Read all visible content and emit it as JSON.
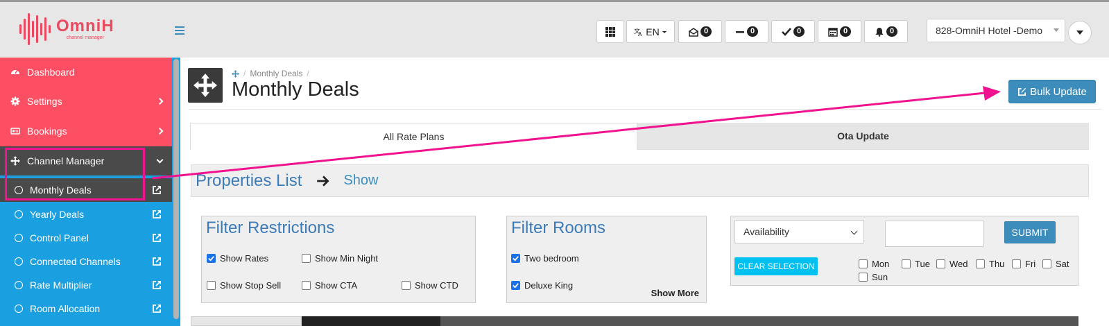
{
  "brand": {
    "name": "OmniH",
    "subtitle": "channel manager",
    "color": "#e84a5f"
  },
  "toolbar": {
    "lang": "EN",
    "counters": [
      {
        "icon": "envelope-open-icon",
        "count": "0"
      },
      {
        "icon": "minus-icon",
        "count": "0"
      },
      {
        "icon": "check-icon",
        "count": "0"
      },
      {
        "icon": "calendar-icon",
        "count": "0"
      },
      {
        "icon": "bell-icon",
        "count": "0"
      }
    ],
    "hotel": "828-OmniH Hotel -Demo"
  },
  "sidebar": {
    "items": [
      {
        "label": "Dashboard",
        "icon": "dashboard-icon"
      },
      {
        "label": "Settings",
        "icon": "gear-icon"
      },
      {
        "label": "Bookings",
        "icon": "bookings-icon"
      },
      {
        "label": "Channel Manager",
        "icon": "move-icon"
      }
    ],
    "subitems": [
      {
        "label": "Monthly Deals"
      },
      {
        "label": "Yearly Deals"
      },
      {
        "label": "Control Panel"
      },
      {
        "label": "Connected Channels"
      },
      {
        "label": "Rate Multiplier"
      },
      {
        "label": "Room Allocation"
      }
    ]
  },
  "page": {
    "breadcrumb": "Monthly Deals",
    "title": "Monthly Deals",
    "bulk_update": "Bulk Update"
  },
  "tabs": [
    {
      "label": "All Rate Plans"
    },
    {
      "label": "Ota Update"
    }
  ],
  "properties": {
    "title": "Properties List",
    "show": "Show"
  },
  "filter_restrictions": {
    "title": "Filter Restrictions",
    "options": [
      {
        "label": "Show Rates",
        "checked": true
      },
      {
        "label": "Show Min Night",
        "checked": false
      },
      {
        "label": "Show Stop Sell",
        "checked": false
      },
      {
        "label": "Show CTA",
        "checked": false
      },
      {
        "label": "Show CTD",
        "checked": false
      }
    ]
  },
  "filter_rooms": {
    "title": "Filter Rooms",
    "options": [
      {
        "label": "Two bedroom",
        "checked": true
      },
      {
        "label": "Deluxe King",
        "checked": true
      }
    ],
    "show_more": "Show More"
  },
  "availability": {
    "selected": "Availability",
    "submit": "SUBMIT",
    "clear": "CLEAR SELECTION",
    "days": [
      "Mon",
      "Tue",
      "Wed",
      "Thu",
      "Fri",
      "Sat",
      "Sun"
    ]
  },
  "colors": {
    "sidebar_red": "#fc4f63",
    "sidebar_blue": "#1aa0e0",
    "accent": "#3c8dbc",
    "annotation": "#f0128f"
  }
}
